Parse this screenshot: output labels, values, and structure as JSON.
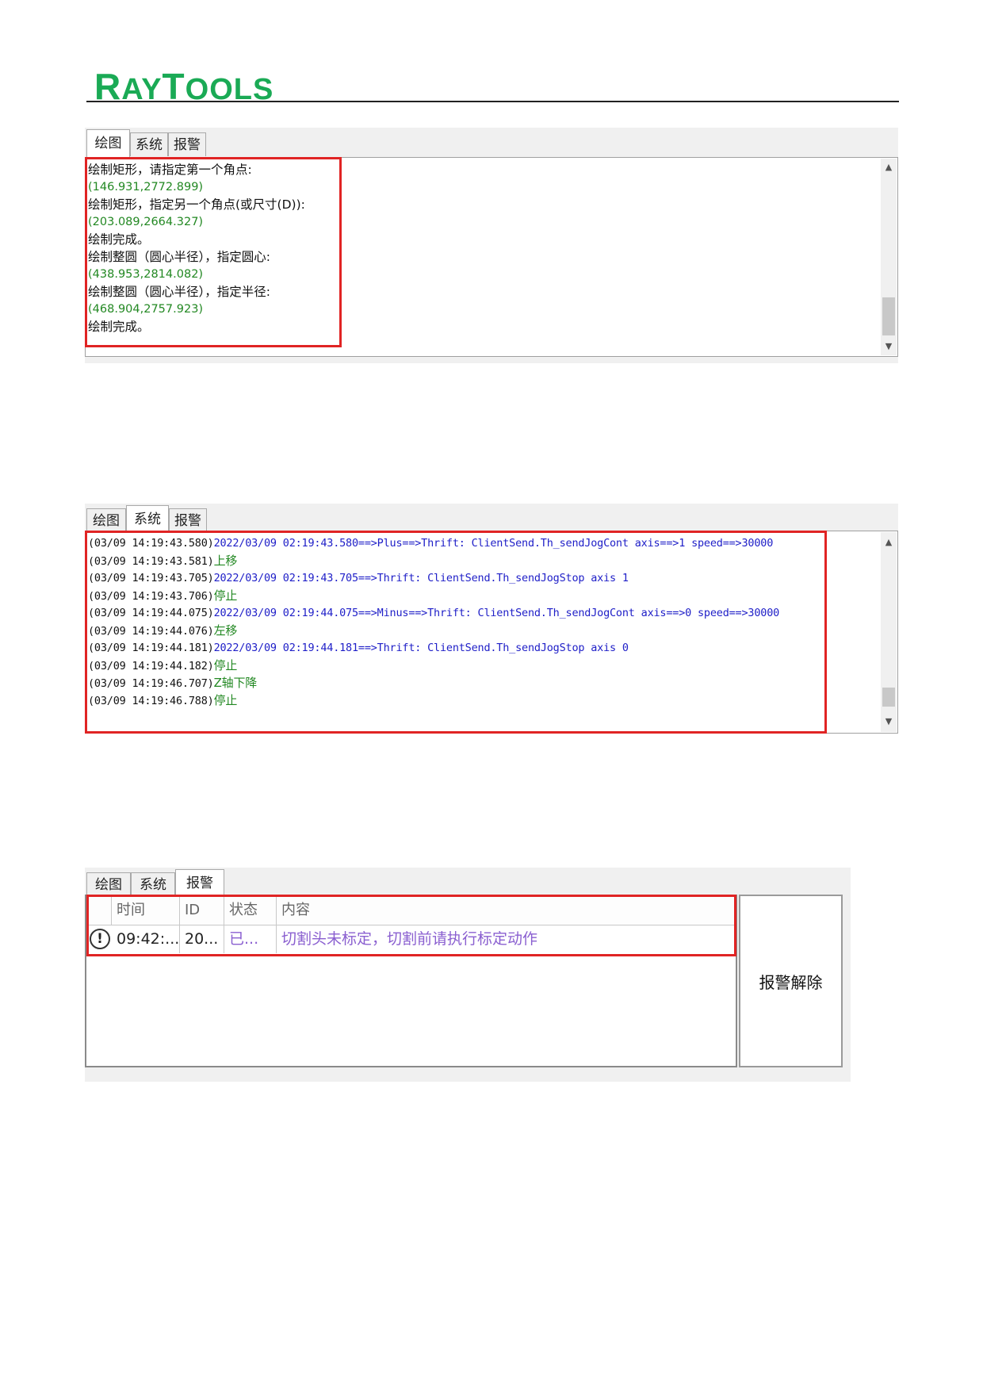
{
  "header": {
    "logo_ray": "R",
    "logo_ay": "AY",
    "logo_tools_t": "T",
    "logo_tools_rest": "OOLS"
  },
  "tabs": [
    "绘图",
    "系统",
    "报警"
  ],
  "drawing_panel": {
    "lines": [
      {
        "text": "绘制矩形，请指定第一个角点:",
        "color": "black"
      },
      {
        "text": "(146.931,2772.899)",
        "color": "green"
      },
      {
        "text": "绘制矩形，指定另一个角点(或尺寸(D)):",
        "color": "black"
      },
      {
        "text": "(203.089,2664.327)",
        "color": "green"
      },
      {
        "text": "绘制完成。",
        "color": "black"
      },
      {
        "text": "绘制整圆（圆心半径），指定圆心:",
        "color": "black"
      },
      {
        "text": "(438.953,2814.082)",
        "color": "green"
      },
      {
        "text": "绘制整圆（圆心半径），指定半径:",
        "color": "black"
      },
      {
        "text": "(468.904,2757.923)",
        "color": "green"
      },
      {
        "text": "绘制完成。",
        "color": "black"
      }
    ]
  },
  "system_panel": {
    "lines": [
      {
        "ts": "(03/09 14:19:43.580)",
        "msg": "2022/03/09 02:19:43.580==>Plus==>Thrift: ClientSend.Th_sendJogCont axis==>1 speed==>30000",
        "color": "blue"
      },
      {
        "ts": "(03/09 14:19:43.581)",
        "msg": "上移",
        "color": "green"
      },
      {
        "ts": "(03/09 14:19:43.705)",
        "msg": "2022/03/09 02:19:43.705==>Thrift: ClientSend.Th_sendJogStop axis 1",
        "color": "blue"
      },
      {
        "ts": "(03/09 14:19:43.706)",
        "msg": "停止",
        "color": "green"
      },
      {
        "ts": "(03/09 14:19:44.075)",
        "msg": "2022/03/09 02:19:44.075==>Minus==>Thrift: ClientSend.Th_sendJogCont axis==>0 speed==>30000",
        "color": "blue"
      },
      {
        "ts": "(03/09 14:19:44.076)",
        "msg": "左移",
        "color": "green"
      },
      {
        "ts": "(03/09 14:19:44.181)",
        "msg": "2022/03/09 02:19:44.181==>Thrift: ClientSend.Th_sendJogStop axis 0",
        "color": "blue"
      },
      {
        "ts": "(03/09 14:19:44.182)",
        "msg": "停止",
        "color": "green"
      },
      {
        "ts": "(03/09 14:19:46.707)",
        "msg": "Z轴下降",
        "color": "green"
      },
      {
        "ts": "(03/09 14:19:46.788)",
        "msg": "停止",
        "color": "green"
      }
    ]
  },
  "alarm_panel": {
    "columns": [
      "时间",
      "ID",
      "状态",
      "内容"
    ],
    "row": {
      "icon": "!",
      "time": "09:42:...",
      "id": "20...",
      "status": "已...",
      "content": "切割头未标定，切割前请执行标定动作"
    },
    "clear_button": "报警解除"
  },
  "colors": {
    "accent": "#1aaa55",
    "highlight": "#e02424",
    "log_blue": "#2020c8",
    "log_green": "#228822",
    "alarm_purple": "#8a5fd0"
  }
}
